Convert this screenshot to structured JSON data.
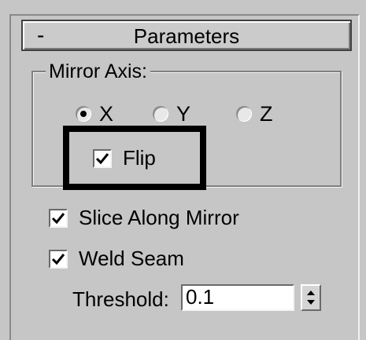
{
  "rollout": {
    "collapse_label": "-",
    "title": "Parameters"
  },
  "mirror_axis": {
    "legend": "Mirror Axis:",
    "options": [
      {
        "label": "X",
        "selected": true
      },
      {
        "label": "Y",
        "selected": false
      },
      {
        "label": "Z",
        "selected": false
      }
    ],
    "flip": {
      "label": "Flip",
      "checked": true
    }
  },
  "slice_along_mirror": {
    "label": "Slice Along Mirror",
    "checked": true
  },
  "weld_seam": {
    "label": "Weld Seam",
    "checked": true
  },
  "threshold": {
    "label": "Threshold:",
    "value": "0.1"
  },
  "icons": {
    "check": "checkmark-icon",
    "spinner_up": "spinner-up-arrow-icon",
    "spinner_down": "spinner-down-arrow-icon"
  }
}
